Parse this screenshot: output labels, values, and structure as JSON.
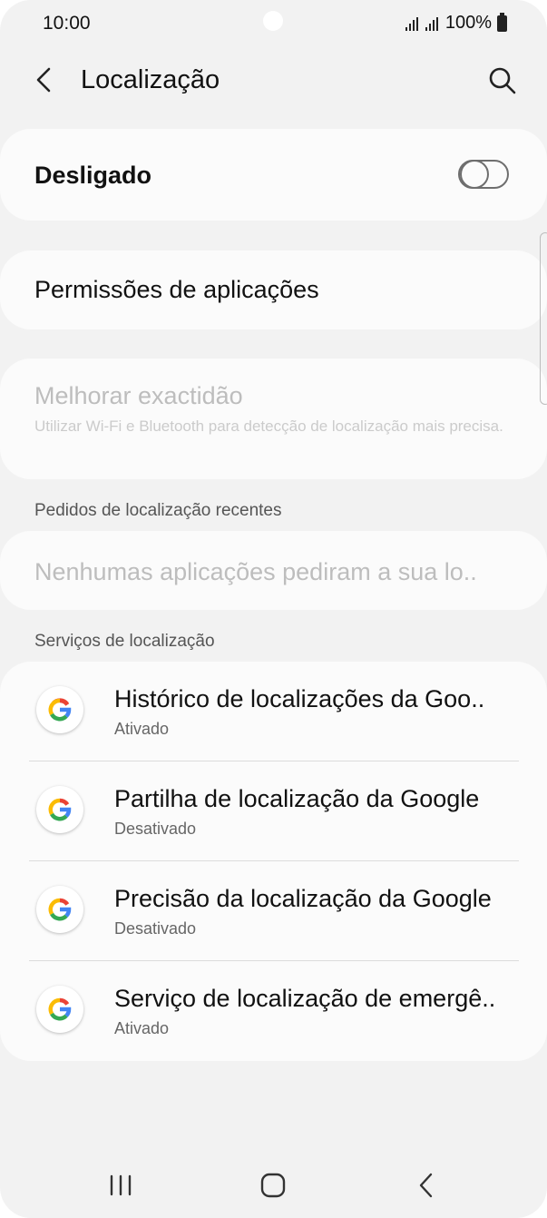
{
  "status_bar": {
    "time": "10:00",
    "battery": "100%"
  },
  "header": {
    "title": "Localização",
    "back_icon": "chevron-left-icon",
    "search_icon": "search-icon"
  },
  "master_switch": {
    "label": "Desligado",
    "enabled": false
  },
  "app_permissions": {
    "label": "Permissões de aplicações"
  },
  "improve_accuracy": {
    "title": "Melhorar exactidão",
    "description": "Utilizar Wi-Fi e Bluetooth para detecção de localização mais precisa."
  },
  "recent_requests": {
    "header": "Pedidos de localização recentes",
    "empty_text": "Nenhumas aplicações pediram a sua lo.."
  },
  "location_services": {
    "header": "Serviços de localização",
    "items": [
      {
        "title": "Histórico de localizações da Goo..",
        "status": "Ativado",
        "icon": "google-icon"
      },
      {
        "title": "Partilha de localização da Google",
        "status": "Desativado",
        "icon": "google-icon"
      },
      {
        "title": "Precisão da localização da Google",
        "status": "Desativado",
        "icon": "google-icon"
      },
      {
        "title": "Serviço de localização de emergê..",
        "status": "Ativado",
        "icon": "google-icon"
      }
    ]
  },
  "nav_bar": {
    "recents_icon": "recents-icon",
    "home_icon": "home-icon",
    "back_icon": "back-icon"
  },
  "colors": {
    "background": "#f2f2f2",
    "card": "#fbfbfb",
    "disabled_text": "#bdbdbd",
    "google_blue": "#4285F4",
    "google_red": "#EA4335",
    "google_yellow": "#FBBC05",
    "google_green": "#34A853"
  }
}
